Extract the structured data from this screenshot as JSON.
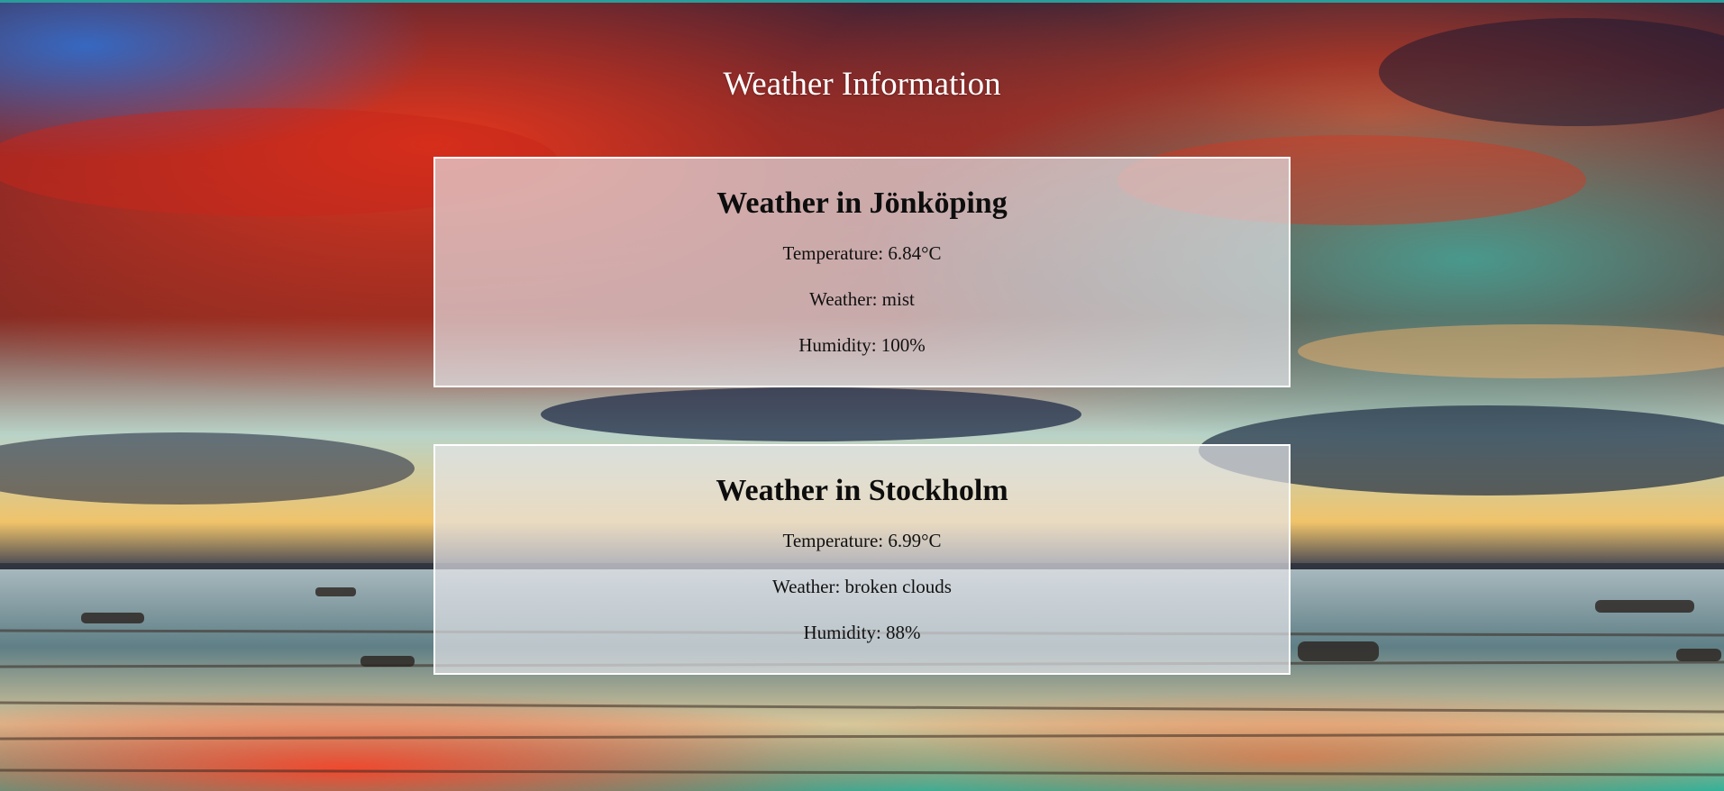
{
  "page": {
    "title": "Weather Information"
  },
  "cities": [
    {
      "heading": "Weather in Jönköping",
      "temperature": "Temperature: 6.84°C",
      "weather": "Weather: mist",
      "humidity": "Humidity: 100%"
    },
    {
      "heading": "Weather in Stockholm",
      "temperature": "Temperature: 6.99°C",
      "weather": "Weather: broken clouds",
      "humidity": "Humidity: 88%"
    }
  ],
  "colors": {
    "card_border": "#ffffff",
    "title_text": "#ffffff",
    "accent_top_bar": "#2a9c9a"
  }
}
